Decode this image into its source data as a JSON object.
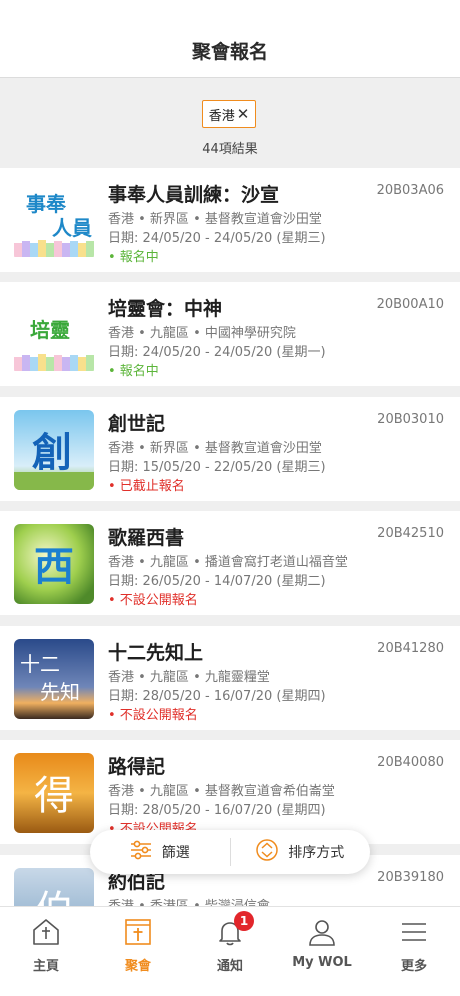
{
  "header": {
    "title": "聚會報名"
  },
  "filters": {
    "chip_label": "香港",
    "chip_close": "✕",
    "result_count": "44項結果"
  },
  "events": [
    {
      "title": "事奉人員訓練：沙宣",
      "code": "20B03A06",
      "location": "香港 • 新界區 • 基督教宣道會沙田堂",
      "date": "日期: 24/05/20 - 24/05/20 (星期三)",
      "status": "• 報名中",
      "thumb_text_1": "事奉",
      "thumb_text_2": "人員"
    },
    {
      "title": "培靈會：中神",
      "code": "20B00A10",
      "location": "香港 • 九龍區 • 中國神學研究院",
      "date": "日期: 24/05/20 - 24/05/20 (星期一)",
      "status": "• 報名中",
      "thumb_text_1": "培靈"
    },
    {
      "title": "創世記",
      "code": "20B03010",
      "location": "香港 • 新界區 • 基督教宣道會沙田堂",
      "date": "日期: 15/05/20 - 22/05/20 (星期三)",
      "status": "• 已截止報名",
      "thumb_text_1": "創"
    },
    {
      "title": "歌羅西書",
      "code": "20B42510",
      "location": "香港 • 九龍區 • 播道會窩打老道山福音堂",
      "date": "日期: 26/05/20 - 14/07/20 (星期二)",
      "status": "• 不設公開報名",
      "thumb_text_1": "西"
    },
    {
      "title": "十二先知上",
      "code": "20B41280",
      "location": "香港 • 九龍區 • 九龍靈糧堂",
      "date": "日期: 28/05/20 - 16/07/20 (星期四)",
      "status": "• 不設公開報名",
      "thumb_text_1": "十二",
      "thumb_text_2": "先知"
    },
    {
      "title": "路得記",
      "code": "20B40080",
      "location": "香港 • 九龍區 • 基督教宣道會希伯崙堂",
      "date": "日期: 28/05/20 - 16/07/20 (星期四)",
      "status": "• 不設公開報名",
      "thumb_text_1": "得"
    },
    {
      "title": "約伯記",
      "code": "20B39180",
      "location": "香港 • 香港區 • 柴灣浸信會",
      "thumb_text_1": "伯"
    }
  ],
  "float_bar": {
    "filter_label": "篩選",
    "sort_label": "排序方式"
  },
  "tabbar": {
    "home": "主頁",
    "events": "聚會",
    "notifications": "通知",
    "notification_badge": "1",
    "mywol": "My WOL",
    "more": "更多"
  },
  "colors": {
    "accent": "#f08c1e",
    "green_status": "#5cb53a",
    "red_status": "#e0302a",
    "badge": "#e2262b"
  }
}
